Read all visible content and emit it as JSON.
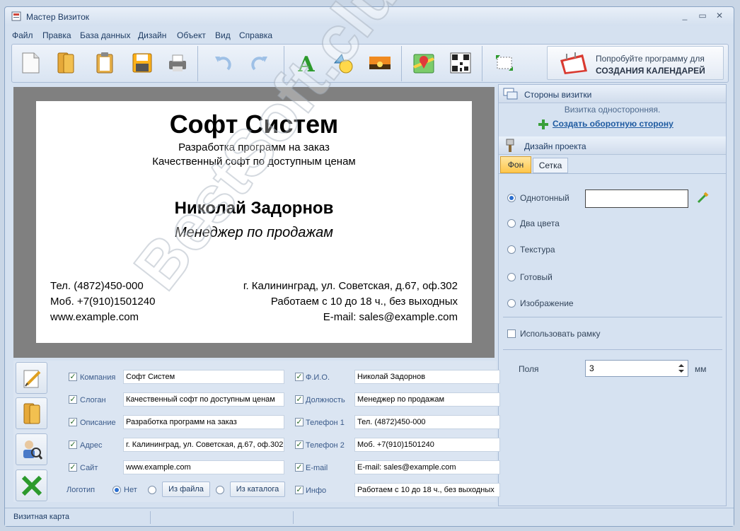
{
  "window": {
    "title": "Мастер Визиток"
  },
  "menu": [
    "Файл",
    "Правка",
    "База данных",
    "Дизайн",
    "Объект",
    "Вид",
    "Справка"
  ],
  "promo": {
    "line1": "Попробуйте программу для",
    "line2": "СОЗДАНИЯ КАЛЕНДАРЕЙ"
  },
  "card": {
    "company": "Софт Систем",
    "description": "Разработка программ на заказ",
    "slogan": "Качественный софт по доступным ценам",
    "name": "Николай Задорнов",
    "position": "Менеджер по продажам",
    "phone1": "Тел. (4872)450-000",
    "phone2": "Моб. +7(910)1501240",
    "site": "www.example.com",
    "address": "г. Калининград, ул. Советская, д.67, оф.302",
    "info": "Работаем с 10 до 18 ч., без выходных",
    "email": "E-mail: sales@example.com"
  },
  "sides": {
    "header": "Стороны визитки",
    "note": "Визитка односторонняя.",
    "create_link": "Создать оборотную сторону"
  },
  "design": {
    "header": "Дизайн проекта",
    "tabs": [
      "Фон",
      "Сетка"
    ],
    "options": [
      "Однотонный",
      "Два цвета",
      "Текстура",
      "Готовый",
      "Изображение"
    ],
    "frame_label": "Использовать рамку",
    "margins_label": "Поля",
    "margins_value": "3",
    "margins_unit": "мм"
  },
  "fields": {
    "left": [
      {
        "label": "Компания",
        "value": "Софт Систем"
      },
      {
        "label": "Слоган",
        "value": "Качественный софт по доступным ценам"
      },
      {
        "label": "Описание",
        "value": "Разработка программ на заказ"
      },
      {
        "label": "Адрес",
        "value": "г. Калининград, ул. Советская, д.67, оф.302"
      },
      {
        "label": "Сайт",
        "value": "www.example.com"
      }
    ],
    "right": [
      {
        "label": "Ф.И.О.",
        "value": "Николай Задорнов"
      },
      {
        "label": "Должность",
        "value": "Менеджер по продажам"
      },
      {
        "label": "Телефон 1",
        "value": "Тел. (4872)450-000"
      },
      {
        "label": "Телефон 2",
        "value": "Моб. +7(910)1501240"
      },
      {
        "label": "E-mail",
        "value": "E-mail: sales@example.com"
      },
      {
        "label": "Инфо",
        "value": "Работаем с 10 до 18 ч., без выходных"
      }
    ],
    "logo_label": "Логотип",
    "logo_none": "Нет",
    "logo_file": "Из файла",
    "logo_catalog": "Из каталога"
  },
  "status": {
    "text": "Визитная карта"
  },
  "watermark": "BestSoft.club"
}
